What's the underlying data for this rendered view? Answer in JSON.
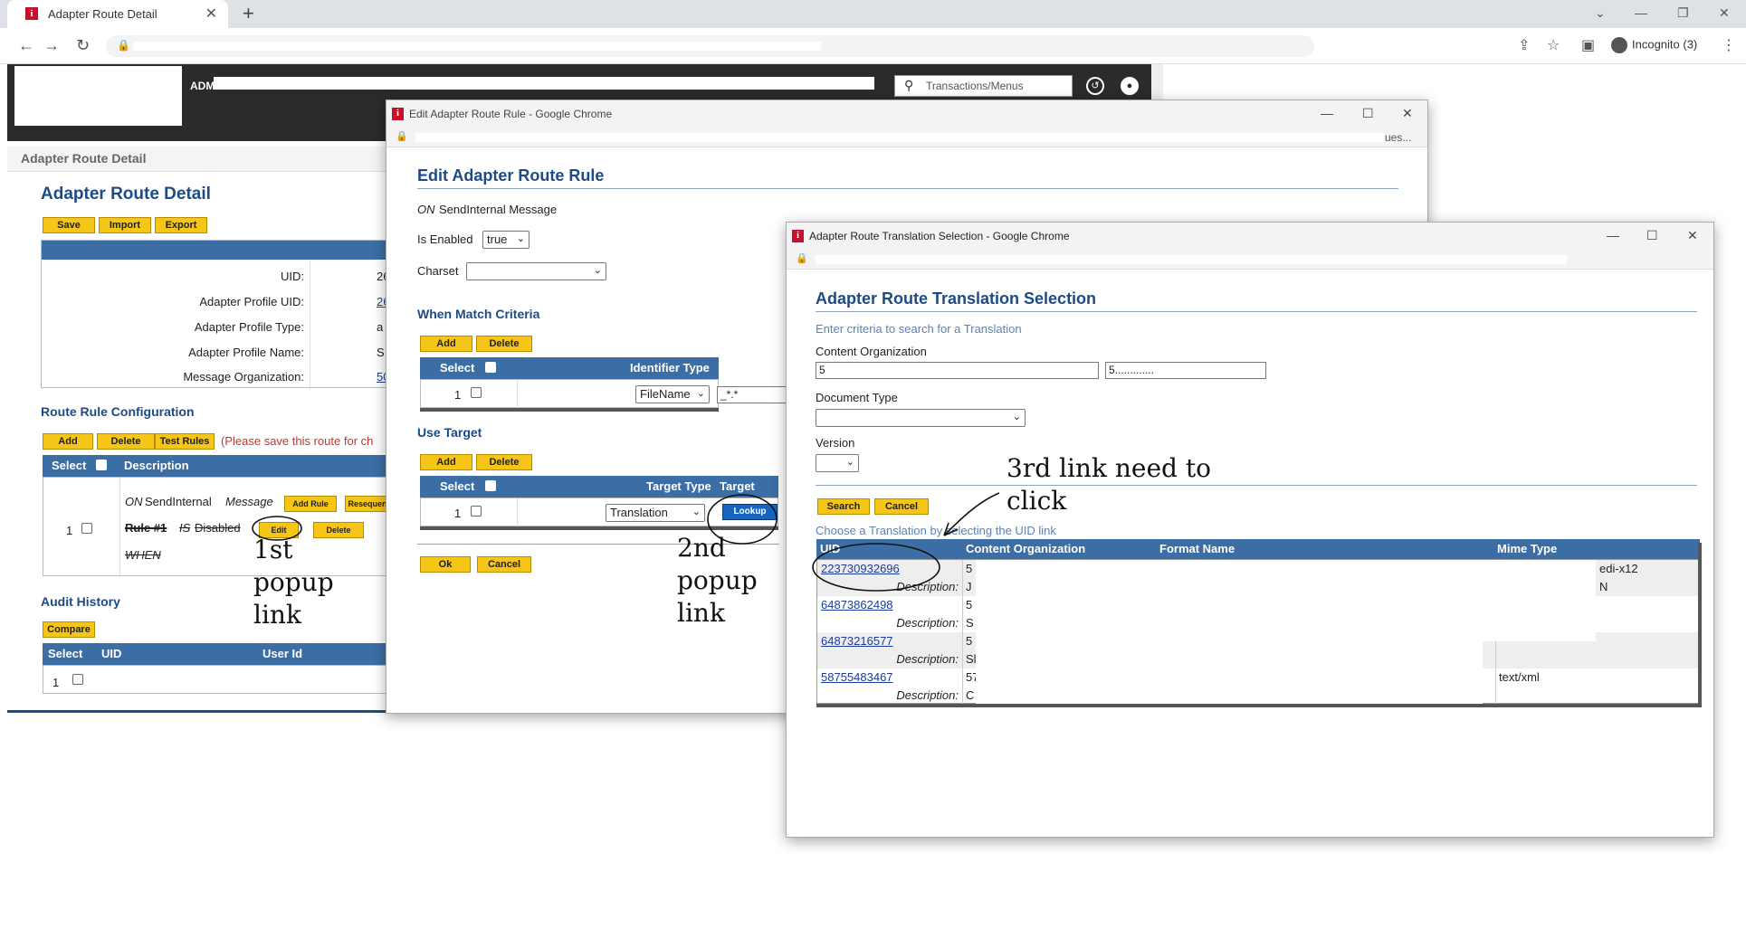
{
  "browser": {
    "tab_title": "Adapter Route Detail",
    "tab_favicon": "i",
    "incognito_label": "Incognito (3)"
  },
  "header": {
    "user_prefix": "ADM",
    "search_placeholder": "Transactions/Menus"
  },
  "main": {
    "breadcrumb": "Adapter Route Detail",
    "title": "Adapter Route Detail",
    "buttons": [
      "Save",
      "Import",
      "Export"
    ],
    "fields": [
      {
        "label": "UID:",
        "value": "26"
      },
      {
        "label": "Adapter Profile UID:",
        "value": "26"
      },
      {
        "label": "Adapter Profile Type:",
        "value": "a"
      },
      {
        "label": "Adapter Profile Name:",
        "value": "S"
      },
      {
        "label": "Message Organization:",
        "value": "50"
      }
    ],
    "route_rule_title": "Route Rule Configuration",
    "route_buttons": [
      "Add",
      "Delete",
      "Test Rules"
    ],
    "route_warning": "(Please save this route for ch",
    "route_table": {
      "col_select": "Select",
      "col_description": "Description",
      "row_num": "1",
      "on_text": "ON",
      "send_text": "SendInternal",
      "message_text": "Message",
      "add_rule": "Add Rule",
      "resequence": "Resequen",
      "rule_label": "Rule #1",
      "is_text": "IS",
      "disabled_text": "Disabled",
      "edit": "Edit",
      "delete": "Delete",
      "when_text": "WHEN"
    },
    "audit_title": "Audit History",
    "compare_button": "Compare",
    "audit_table": {
      "col_select": "Select",
      "col_uid": "UID",
      "col_userid": "User Id",
      "row_num": "1"
    }
  },
  "popup1": {
    "window_title": "Edit Adapter Route Rule - Google Chrome",
    "address_tail": "ues...",
    "title": "Edit Adapter Route Rule",
    "on_label": "ON",
    "on_value": "SendInternal Message",
    "enabled_label": "Is Enabled",
    "enabled_value": "true",
    "charset_label": "Charset",
    "charset_value": "",
    "match_title": "When Match Criteria",
    "match_buttons": [
      "Add",
      "Delete"
    ],
    "match_cols": {
      "select": "Select",
      "identifier_type": "Identifier Type",
      "identifier_value": "Identifier Valu"
    },
    "match_row": {
      "num": "1",
      "type": "FileName",
      "value": "_*.*"
    },
    "target_title": "Use Target",
    "target_buttons": [
      "Add",
      "Delete"
    ],
    "target_cols": {
      "select": "Select",
      "target_type": "Target Type",
      "target": "Target"
    },
    "target_row": {
      "num": "1",
      "type": "Translation",
      "lookup": "Lookup"
    },
    "ok": "Ok",
    "cancel": "Cancel"
  },
  "popup2": {
    "window_title": "Adapter Route Translation Selection - Google Chrome",
    "title": "Adapter Route Translation Selection",
    "hint": "Enter criteria to search for a Translation",
    "content_org_label": "Content Organization",
    "content_org_value": "5",
    "content_org_value2": "5.............",
    "doc_type_label": "Document Type",
    "version_label": "Version",
    "search": "Search",
    "cancel": "Cancel",
    "choose_hint": "Choose a Translation by selecting the UID link",
    "cols": {
      "uid": "UID",
      "content_org": "Content Organization",
      "format_name": "Format Name",
      "mime_type": "Mime Type"
    },
    "description_label": "Description:",
    "rows": [
      {
        "uid": "223730932696",
        "org": "5",
        "desc": "J",
        "mime": "edi-x12",
        "mime2": "N"
      },
      {
        "uid": "64873862498",
        "org": "5",
        "desc": "S",
        "mime": "",
        "mime2": ""
      },
      {
        "uid": "64873216577",
        "org": "5",
        "desc": "Sl",
        "mime": "",
        "mime2": ""
      },
      {
        "uid": "58755483467",
        "org": "57",
        "desc": "C",
        "mime": "text/xml",
        "mime2": ""
      }
    ]
  },
  "annotations": {
    "first": "1st\npopup\nlink",
    "second": "2nd\npopup\nlink",
    "third": "3rd link need to\nclick"
  },
  "colors": {
    "accent_blue": "#3b6ea5",
    "button_yellow": "#f5c518",
    "title_blue": "#1c4b87"
  }
}
